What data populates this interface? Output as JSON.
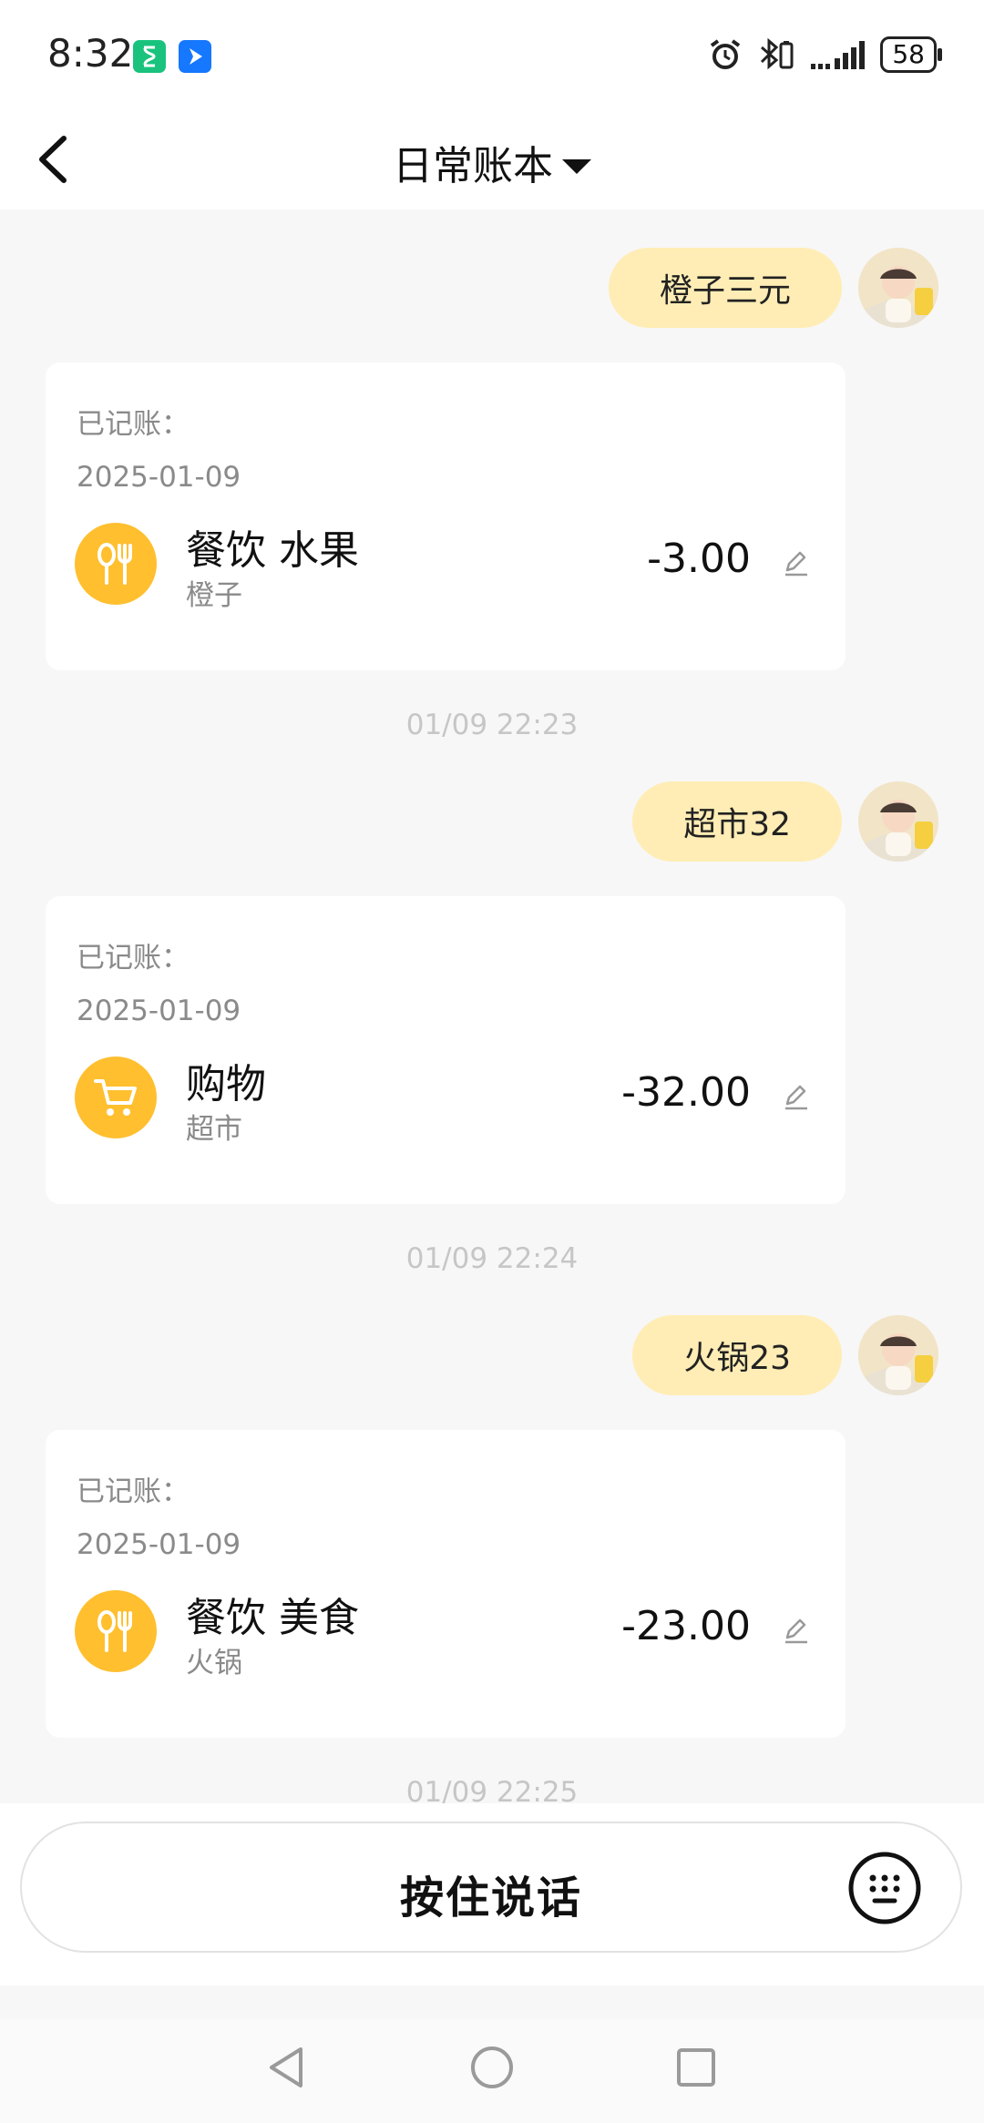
{
  "status": {
    "time": "8:32",
    "battery": "58"
  },
  "header": {
    "title": "日常账本"
  },
  "messages": [
    {
      "text": "橙子三元",
      "label": "已记账：",
      "date": "2025-01-09",
      "category": "餐饮 水果",
      "note": "橙子",
      "amount": "-3.00",
      "icon": "utensils-icon",
      "timestamp": "01/09 22:23"
    },
    {
      "text": "超市32",
      "label": "已记账：",
      "date": "2025-01-09",
      "category": "购物",
      "note": "超市",
      "amount": "-32.00",
      "icon": "cart-icon",
      "timestamp": "01/09 22:24"
    },
    {
      "text": "火锅23",
      "label": "已记账：",
      "date": "2025-01-09",
      "category": "餐饮 美食",
      "note": "火锅",
      "amount": "-23.00",
      "icon": "utensils-icon",
      "timestamp": "01/09 22:25"
    }
  ],
  "bottom": {
    "talk_label": "按住说话"
  },
  "colors": {
    "accent": "#ffbf2f",
    "bubble": "#ffedb5",
    "background": "#f7f7f7"
  }
}
